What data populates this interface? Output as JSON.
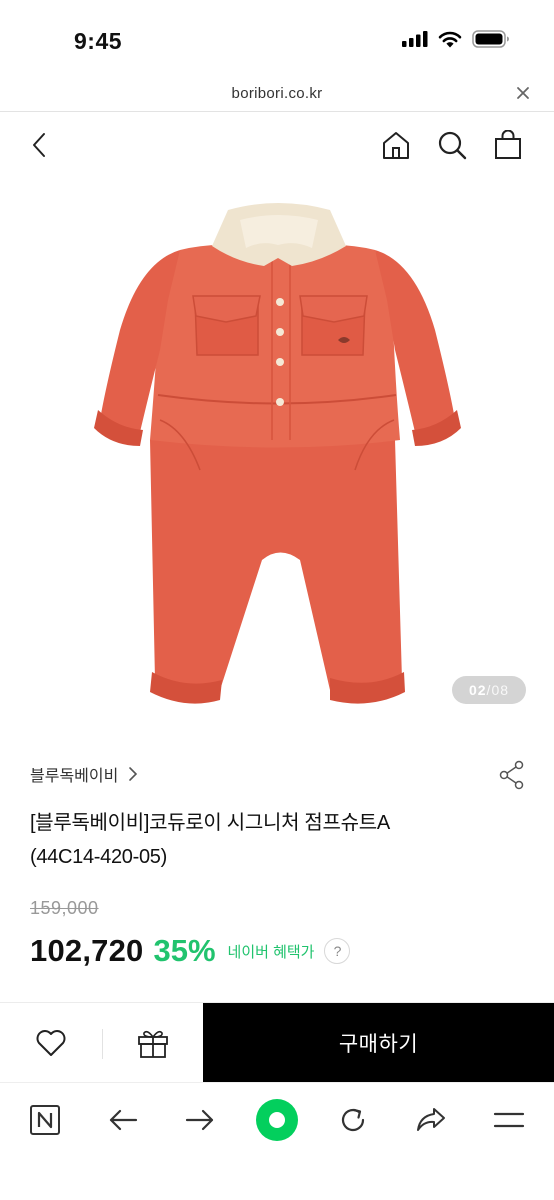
{
  "status_bar": {
    "time": "9:45",
    "icons": [
      "signal-icon",
      "wifi-icon",
      "battery-icon"
    ]
  },
  "url_bar": {
    "url": "boribori.co.kr",
    "close_icon": "close-icon"
  },
  "header": {
    "back_icon": "back-arrow-icon",
    "home_icon": "home-icon",
    "search_icon": "search-icon",
    "cart_icon": "shopping-bag-icon"
  },
  "gallery": {
    "current": "02",
    "separator": "/",
    "total": "08"
  },
  "product": {
    "brand": "블루독베이비",
    "title_line1": "[블루독베이비]코듀로이 시그니처 점프슈트A",
    "title_line2": "(44C14-420-05)",
    "original_price": "159,000",
    "sale_price": "102,720",
    "discount": "35%",
    "benefit_label": "네이버 혜택가",
    "help_label": "?"
  },
  "purchase_bar": {
    "buy_label": "구매하기"
  },
  "colors": {
    "accent_green": "#21c36e",
    "buy_button": "#000000",
    "garment": "#e5624a",
    "collar": "#efe4cf"
  },
  "browser_toolbar": {
    "items": [
      "naver-n-icon",
      "back-icon",
      "forward-icon",
      "green-home-icon",
      "reload-icon",
      "share-icon",
      "menu-icon"
    ]
  }
}
